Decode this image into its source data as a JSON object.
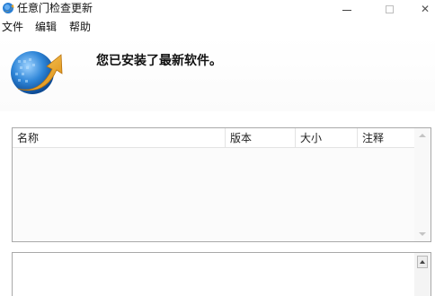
{
  "window": {
    "title": "任意门检查更新",
    "icon": "globe-update-icon",
    "controls": {
      "minimize": "minimize-icon",
      "maximize": "maximize-icon",
      "close": "close-icon"
    },
    "close_glyph": "✕"
  },
  "menu": {
    "items": [
      {
        "label": "文件"
      },
      {
        "label": "编辑"
      },
      {
        "label": "帮助"
      }
    ]
  },
  "banner": {
    "message": "您已安装了最新软件。",
    "icon": "globe-arrow-icon",
    "colors": {
      "globe": "#1e6fc4",
      "arrow": "#e8a11a"
    }
  },
  "list": {
    "columns": [
      {
        "label": "名称"
      },
      {
        "label": "版本"
      },
      {
        "label": "大小"
      },
      {
        "label": "注释"
      }
    ],
    "rows": []
  },
  "notes": {
    "value": ""
  }
}
